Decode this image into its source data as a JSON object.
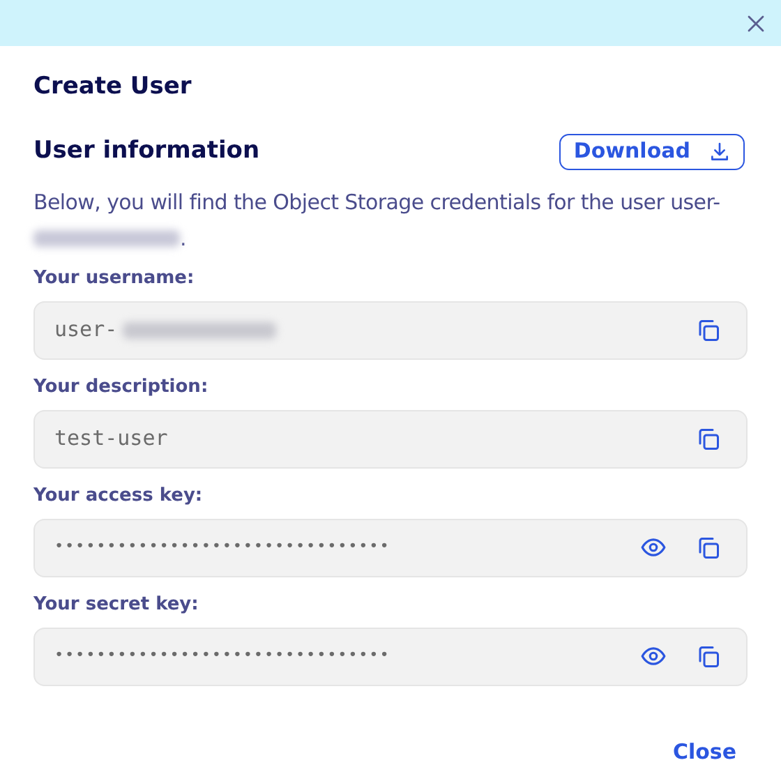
{
  "dialog": {
    "title": "Create User"
  },
  "section": {
    "title": "User information",
    "download_button": "Download",
    "description": "Below, you will find the Object Storage credentials for the user user-",
    "description_end": "."
  },
  "fields": [
    {
      "label": "Your username:",
      "value": "user-",
      "kind": "redacted"
    },
    {
      "label": "Your description:",
      "value": "test-user",
      "kind": "text"
    },
    {
      "label": "Your access key:",
      "value": "••••••••••••••••••••••••••••••••",
      "kind": "secret"
    },
    {
      "label": "Your secret key:",
      "value": "••••••••••••••••••••••••••••••••",
      "kind": "secret"
    }
  ],
  "footer": {
    "close_button": "Close"
  }
}
